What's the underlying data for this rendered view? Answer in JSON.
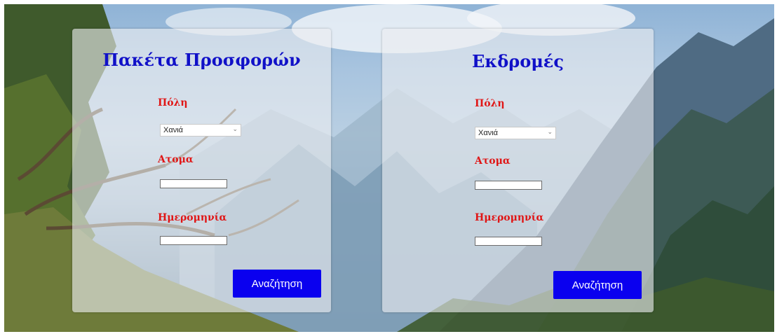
{
  "offers_panel": {
    "title": "Πακέτα Προσφορών",
    "city_label": "Πόλη",
    "city_selected": "Χανιά",
    "people_label": "Ατομα",
    "people_value": "",
    "date_label": "Ημερομηνία",
    "date_value": "",
    "search_label": "Αναζήτηση"
  },
  "excursions_panel": {
    "title": "Εκδρομές",
    "city_label": "Πόλη",
    "city_selected": "Χανιά",
    "people_label": "Ατομα",
    "people_value": "",
    "date_label": "Ημερομηνία",
    "date_value": "",
    "search_label": "Αναζήτηση"
  },
  "colors": {
    "title": "#1010c8",
    "label": "#e01616",
    "button": "#0a00ef"
  },
  "icons": {
    "dropdown": "chevron-down-icon"
  }
}
